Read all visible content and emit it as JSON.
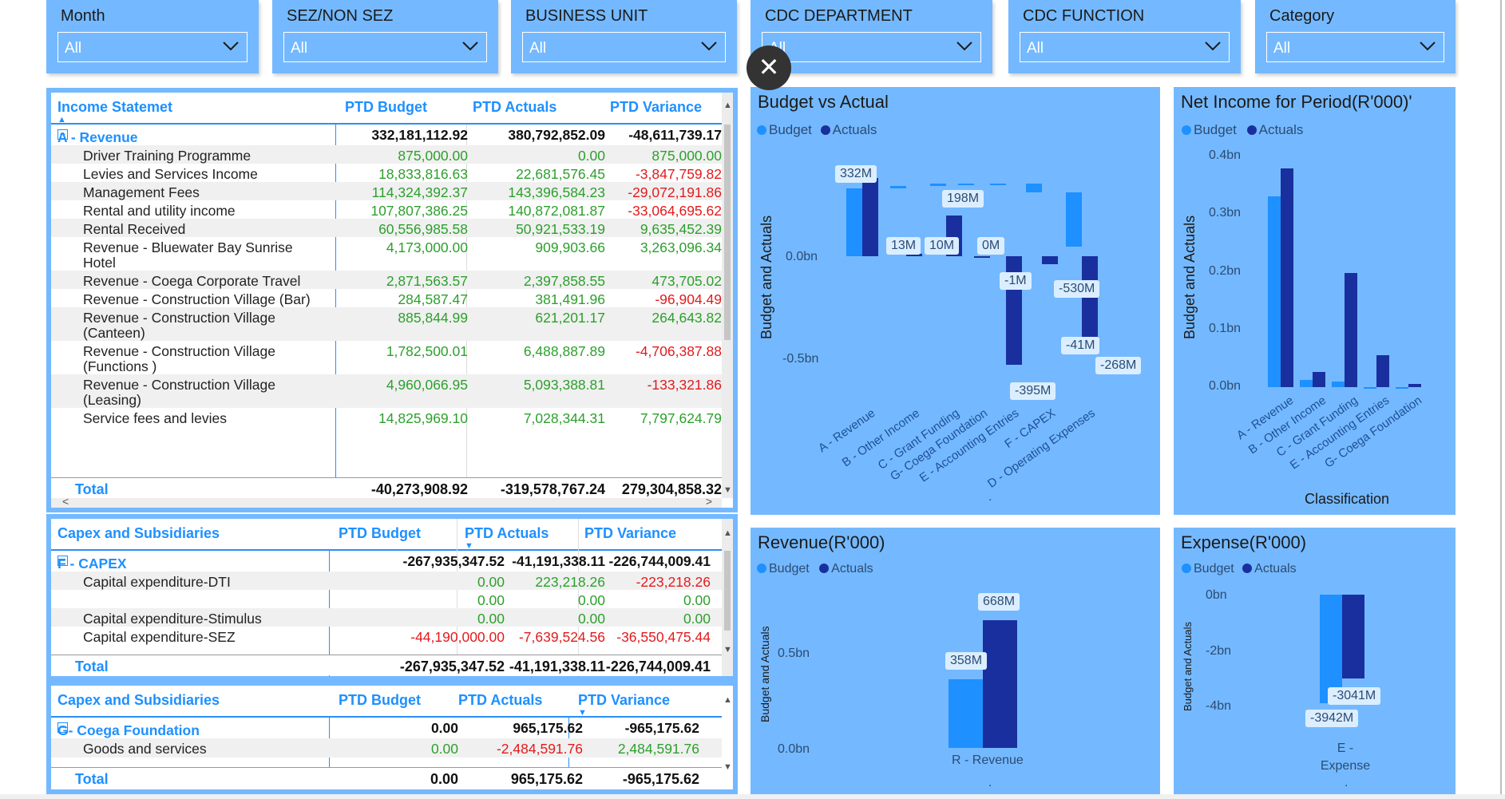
{
  "colors": {
    "budget": "#1e90ff",
    "actuals": "#1a2f9e",
    "panel": "#74b9ff",
    "header": "#1e90ff",
    "positive": "#2ca02c",
    "negative": "#e31a1c"
  },
  "slicers": [
    {
      "title": "Month",
      "value": "All"
    },
    {
      "title": "SEZ/NON SEZ",
      "value": "All"
    },
    {
      "title": "BUSINESS UNIT",
      "value": "All"
    },
    {
      "title": "CDC DEPARTMENT",
      "value": "All"
    },
    {
      "title": "CDC FUNCTION",
      "value": "All"
    },
    {
      "title": "Category",
      "value": "All"
    }
  ],
  "table1": {
    "headers": [
      "Income Statemet",
      "PTD Budget",
      "PTD Actuals",
      "PTD Variance"
    ],
    "group": {
      "expander": "⊟",
      "label": "A - Revenue",
      "budget": "332,181,112.92",
      "actuals": "380,792,852.09",
      "variance": "-48,611,739.17"
    },
    "rows": [
      {
        "label": "Driver Training Programme",
        "label2": "",
        "budget": "875,000.00",
        "actuals": "0.00",
        "variance": "875,000.00"
      },
      {
        "label": "Levies and Services Income",
        "label2": "",
        "budget": "18,833,816.63",
        "actuals": "22,681,576.45",
        "variance": "-3,847,759.82"
      },
      {
        "label": "Management Fees",
        "label2": "",
        "budget": "114,324,392.37",
        "actuals": "143,396,584.23",
        "variance": "-29,072,191.86"
      },
      {
        "label": "Rental and utility income",
        "label2": "",
        "budget": "107,807,386.25",
        "actuals": "140,872,081.87",
        "variance": "-33,064,695.62"
      },
      {
        "label": "Rental Received",
        "label2": "",
        "budget": "60,556,985.58",
        "actuals": "50,921,533.19",
        "variance": "9,635,452.39"
      },
      {
        "label": "Revenue - Bluewater Bay Sunrise",
        "label2": "Hotel",
        "budget": "4,173,000.00",
        "actuals": "909,903.66",
        "variance": "3,263,096.34"
      },
      {
        "label": "Revenue - Coega Corporate Travel",
        "label2": "",
        "budget": "2,871,563.57",
        "actuals": "2,397,858.55",
        "variance": "473,705.02"
      },
      {
        "label": "Revenue - Construction Village (Bar)",
        "label2": "",
        "budget": "284,587.47",
        "actuals": "381,491.96",
        "variance": "-96,904.49"
      },
      {
        "label": "Revenue - Construction Village",
        "label2": "(Canteen)",
        "budget": "885,844.99",
        "actuals": "621,201.17",
        "variance": "264,643.82"
      },
      {
        "label": "Revenue - Construction Village",
        "label2": "(Functions )",
        "budget": "1,782,500.01",
        "actuals": "6,488,887.89",
        "variance": "-4,706,387.88"
      },
      {
        "label": "Revenue - Construction Village",
        "label2": "(Leasing)",
        "budget": "4,960,066.95",
        "actuals": "5,093,388.81",
        "variance": "-133,321.86"
      },
      {
        "label": "Service fees and levies",
        "label2": "",
        "budget": "14,825,969.10",
        "actuals": "7,028,344.31",
        "variance": "7,797,624.79"
      }
    ],
    "total": {
      "label": "Total",
      "budget": "-40,273,908.92",
      "actuals": "-319,578,767.24",
      "variance": "279,304,858.32"
    }
  },
  "table2": {
    "headers": [
      "Capex and Subsidiaries",
      "PTD Budget",
      "PTD Actuals",
      "PTD Variance"
    ],
    "group": {
      "expander": "⊟",
      "label": "F - CAPEX",
      "budget": "-267,935,347.52",
      "actuals": "-41,191,338.11",
      "variance": "-226,744,009.41"
    },
    "rows": [
      {
        "label": "Capital expenditure-DTI",
        "budget": "0.00",
        "actuals": "223,218.26",
        "variance": "-223,218.26"
      },
      {
        "label": "",
        "budget": "0.00",
        "actuals": "0.00",
        "variance": "0.00"
      },
      {
        "label": "Capital expenditure-Stimulus",
        "budget": "0.00",
        "actuals": "0.00",
        "variance": "0.00"
      },
      {
        "label": "Capital expenditure-SEZ",
        "budget": "-44,190,000.00",
        "actuals": "-7,639,524.56",
        "variance": "-36,550,475.44"
      }
    ],
    "total": {
      "label": "Total",
      "budget": "-267,935,347.52",
      "actuals": "-41,191,338.11",
      "variance": "-226,744,009.41"
    }
  },
  "table3": {
    "headers": [
      "Capex and Subsidiaries",
      "PTD Budget",
      "PTD Actuals",
      "PTD Variance"
    ],
    "group": {
      "expander": "⊟",
      "label": "G- Coega Foundation",
      "budget": "0.00",
      "actuals": "965,175.62",
      "variance": "-965,175.62"
    },
    "rows": [
      {
        "label": "Goods and services",
        "budget": "0.00",
        "actuals": "-2,484,591.76",
        "variance": "2,484,591.76"
      }
    ],
    "total": {
      "label": "Total",
      "budget": "0.00",
      "actuals": "965,175.62",
      "variance": "-965,175.62"
    }
  },
  "close_button": "✕",
  "charts": {
    "bva": {
      "title": "Budget vs Actual",
      "legend": [
        "Budget",
        "Actuals"
      ],
      "ylabel": "Budget and Actuals",
      "ticks": [
        "0.0bn",
        "-0.5bn"
      ],
      "dot": "."
    },
    "net": {
      "title": "Net Income for Period(R'000)'",
      "legend": [
        "Budget",
        "Actuals"
      ],
      "ylabel": "Budget and Actuals",
      "xlabel": "Classification",
      "ticks": [
        "0.4bn",
        "0.3bn",
        "0.2bn",
        "0.1bn",
        "0.0bn"
      ]
    },
    "rev": {
      "title": "Revenue(R'000)",
      "legend": [
        "Budget",
        "Actuals"
      ],
      "ylabel": "Budget and Actuals",
      "ticks": [
        "0.5bn",
        "0.0bn"
      ],
      "dot": "."
    },
    "exp": {
      "title": "Expense(R'000)",
      "legend": [
        "Budget",
        "Actuals"
      ],
      "ylabel": "Budget and Actuals",
      "ticks": [
        "0bn",
        "-2bn",
        "-4bn"
      ],
      "dot": "."
    }
  },
  "chart_data": [
    {
      "type": "bar",
      "title": "Budget vs Actual",
      "ylabel": "Budget and Actuals",
      "categories": [
        "A - Revenue",
        "B - Other Income",
        "C - Grant Funding",
        "G- Coega Foundation",
        "E - Accounting Entries",
        "F - CAPEX",
        "D - Operating Expenses"
      ],
      "series": [
        {
          "name": "Budget",
          "values": [
            0.332,
            0.013,
            0.01,
            0.0,
            -0.001,
            -0.041,
            -0.268
          ]
        },
        {
          "name": "Actuals",
          "values": [
            0.381,
            0.013,
            0.198,
            0.0,
            -0.53,
            -0.041,
            -0.395
          ]
        }
      ],
      "data_labels": [
        "332M",
        "13M",
        "10M",
        "198M",
        "0M",
        "-1M",
        "-530M",
        "-41M",
        "-268M",
        "-395M"
      ],
      "yunit": "bn",
      "ylim": [
        -0.75,
        0.5
      ]
    },
    {
      "type": "bar",
      "title": "Net Income for Period(R'000)'",
      "xlabel": "Classification",
      "ylabel": "Budget and Actuals",
      "categories": [
        "A - Revenue",
        "B - Other Income",
        "C - Grant Funding",
        "E - Accounting Entries",
        "G- Coega Foundation"
      ],
      "series": [
        {
          "name": "Budget",
          "values": [
            0.332,
            0.013,
            0.01,
            0.0,
            0.0
          ]
        },
        {
          "name": "Actuals",
          "values": [
            0.381,
            0.026,
            0.198,
            0.056,
            0.005
          ]
        }
      ],
      "yunit": "bn",
      "ylim": [
        0,
        0.4
      ]
    },
    {
      "type": "bar",
      "title": "Revenue(R'000)",
      "ylabel": "Budget and Actuals",
      "categories": [
        "R - Revenue"
      ],
      "series": [
        {
          "name": "Budget",
          "values": [
            358
          ]
        },
        {
          "name": "Actuals",
          "values": [
            668
          ]
        }
      ],
      "data_labels": [
        "358M",
        "668M"
      ],
      "yunit": "M",
      "ylim": [
        0,
        750
      ]
    },
    {
      "type": "bar",
      "title": "Expense(R'000)",
      "ylabel": "Budget and Actuals",
      "categories": [
        "E - Expense"
      ],
      "series": [
        {
          "name": "Budget",
          "values": [
            -3942
          ]
        },
        {
          "name": "Actuals",
          "values": [
            -3041
          ]
        }
      ],
      "data_labels": [
        "-3942M",
        "-3041M"
      ],
      "yunit": "M",
      "ylim": [
        -5000,
        0
      ]
    }
  ]
}
